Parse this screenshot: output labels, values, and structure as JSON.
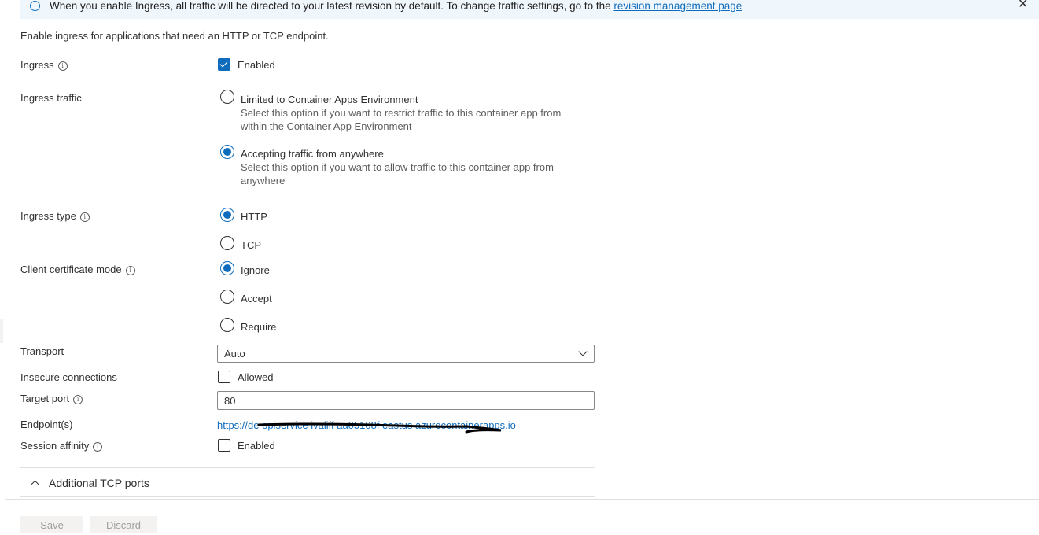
{
  "banner": {
    "text": "When you enable Ingress, all traffic will be directed to your latest revision by default. To change traffic settings, go to the ",
    "link": "revision management page",
    "info_glyph": "i",
    "close_glyph": "✕"
  },
  "intro": "Enable ingress for applications that need an HTTP or TCP endpoint.",
  "fields": {
    "ingress": {
      "label": "Ingress",
      "checkbox_label": "Enabled",
      "checked": true
    },
    "ingress_traffic": {
      "label": "Ingress traffic",
      "options": [
        {
          "label": "Limited to Container Apps Environment",
          "description": "Select this option if you want to restrict traffic to this container app from within the Container App Environment",
          "selected": false
        },
        {
          "label": "Accepting traffic from anywhere",
          "description": "Select this option if you want to allow traffic to this container app from anywhere",
          "selected": true
        }
      ]
    },
    "ingress_type": {
      "label": "Ingress type",
      "options": [
        {
          "label": "HTTP",
          "selected": true
        },
        {
          "label": "TCP",
          "selected": false
        }
      ]
    },
    "client_cert_mode": {
      "label": "Client certificate mode",
      "options": [
        {
          "label": "Ignore",
          "selected": true
        },
        {
          "label": "Accept",
          "selected": false
        },
        {
          "label": "Require",
          "selected": false
        }
      ]
    },
    "transport": {
      "label": "Transport",
      "value": "Auto"
    },
    "insecure": {
      "label": "Insecure connections",
      "checkbox_label": "Allowed",
      "checked": false
    },
    "target_port": {
      "label": "Target port",
      "value": "80"
    },
    "endpoints": {
      "label": "Endpoint(s)",
      "url_visible": "https://de  opiservice ivaliff  aa05108f  eastus  azurecontainerapps.io"
    },
    "session_affinity": {
      "label": "Session affinity",
      "checkbox_label": "Enabled",
      "checked": false
    }
  },
  "section": {
    "title": "Additional TCP ports",
    "expanded": true
  },
  "buttons": {
    "save": "Save",
    "discard": "Discard"
  },
  "colors": {
    "accent": "#0f6cbd",
    "banner_bg": "#eff6fc"
  },
  "icons": {
    "info": "info-icon",
    "close": "close-icon",
    "chevron_down": "chevron-down-icon",
    "chevron_up": "chevron-up-icon"
  }
}
